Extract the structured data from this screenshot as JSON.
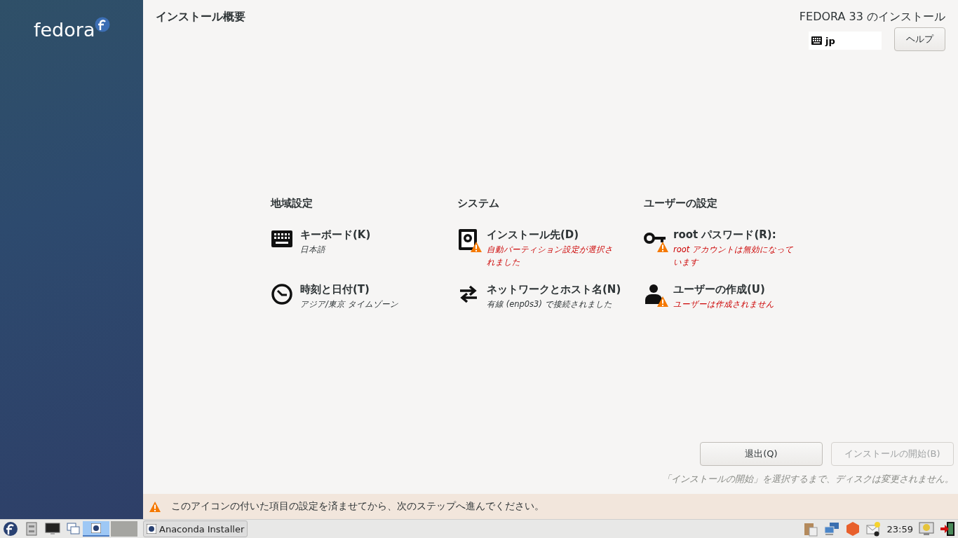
{
  "sidebar": {
    "logo_text": "fedora"
  },
  "header": {
    "title": "インストール概要",
    "product": "FEDORA 33 のインストール",
    "keyboard_layout": "jp",
    "help_button": "ヘルプ"
  },
  "hub": {
    "categories": [
      {
        "title": "地域設定",
        "spokes": [
          {
            "kind": "keyboard",
            "title": "キーボード(K)",
            "status": "日本語",
            "warning": false
          },
          {
            "kind": "clock",
            "title": "時刻と日付(T)",
            "status": "アジア/東京 タイムゾーン",
            "warning": false
          }
        ]
      },
      {
        "title": "システム",
        "spokes": [
          {
            "kind": "disk",
            "title": "インストール先(D)",
            "status": "自動パーティション設定が選択されました",
            "warning": true
          },
          {
            "kind": "network",
            "title": "ネットワークとホスト名(N)",
            "status": "有線 (enp0s3) で接続されました",
            "warning": false
          }
        ]
      },
      {
        "title": "ユーザーの設定",
        "spokes": [
          {
            "kind": "key",
            "title": "root パスワード(R):",
            "status": "root アカウントは無効になっています",
            "warning": true
          },
          {
            "kind": "user",
            "title": "ユーザーの作成(U)",
            "status": "ユーザーは作成されません",
            "warning": true
          }
        ]
      }
    ]
  },
  "buttons": [
    {
      "label": "退出(Q)",
      "disabled": false
    },
    {
      "label": "インストールの開始(B)",
      "disabled": true
    }
  ],
  "note": "「インストールの開始」を選択するまで、ディスクは変更されません。",
  "warning_bar": {
    "text": "このアイコンの付いた項目の設定を済ませてから、次のステップへ進んでください。"
  },
  "taskbar": {
    "launchers": [
      {
        "kind": "fedora"
      },
      {
        "kind": "cabinet"
      },
      {
        "kind": "monitor"
      },
      {
        "kind": "windows"
      }
    ],
    "workspaces": [
      {
        "selected": true
      },
      {
        "selected": false
      }
    ],
    "tasks": [
      {
        "label": "Anaconda Installer"
      }
    ],
    "tray": [
      {
        "kind": "clipboard"
      },
      {
        "kind": "network"
      },
      {
        "kind": "hexagon"
      },
      {
        "kind": "mail"
      }
    ],
    "clock": "23:59",
    "tray_end": [
      {
        "kind": "monitor-badge"
      },
      {
        "kind": "exit"
      }
    ]
  }
}
